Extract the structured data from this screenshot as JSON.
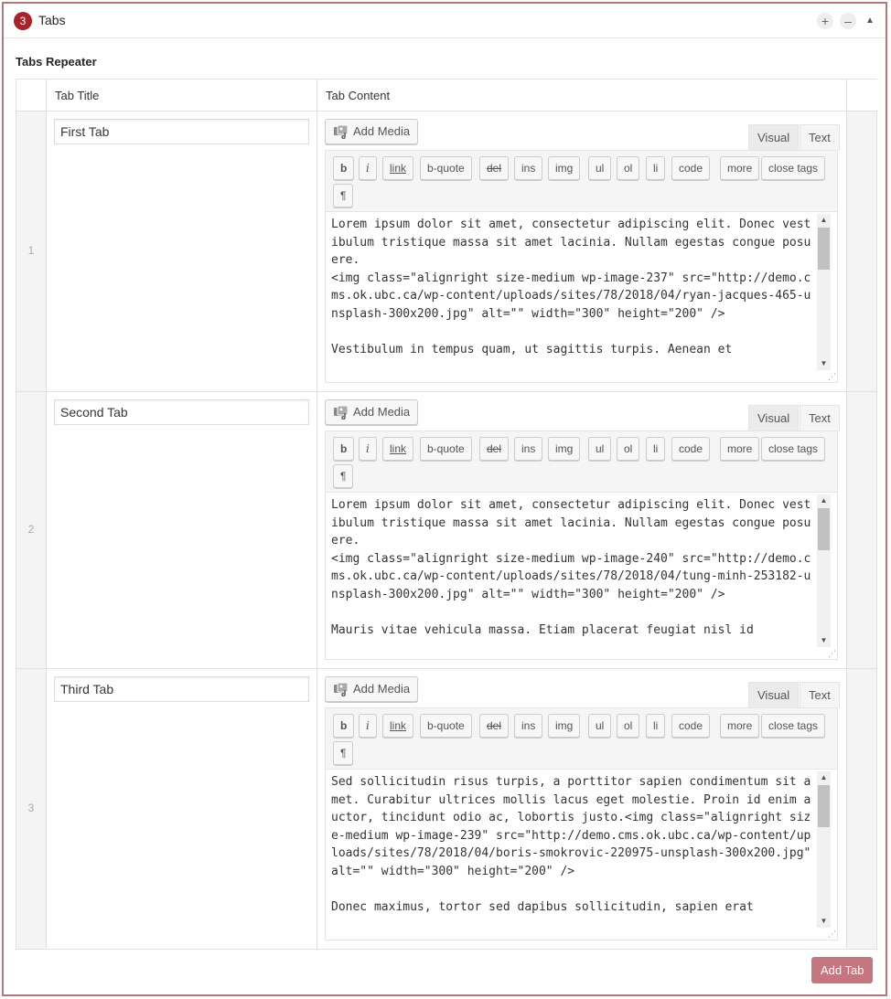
{
  "panel": {
    "badge_count": "3",
    "title": "Tabs",
    "add_symbol": "+",
    "remove_symbol": "–",
    "collapse_symbol": "▲"
  },
  "field": {
    "label": "Tabs Repeater",
    "columns": {
      "tab_title": "Tab Title",
      "tab_content": "Tab Content"
    },
    "rows": [
      {
        "index": "1",
        "title": "First Tab",
        "content": "Lorem ipsum dolor sit amet, consectetur adipiscing elit. Donec vestibulum tristique massa sit amet lacinia. Nullam egestas congue posuere.\n<img class=\"alignright size-medium wp-image-237\" src=\"http://demo.cms.ok.ubc.ca/wp-content/uploads/sites/78/2018/04/ryan-jacques-465-unsplash-300x200.jpg\" alt=\"\" width=\"300\" height=\"200\" />\n\nVestibulum in tempus quam, ut sagittis turpis. Aenean et"
      },
      {
        "index": "2",
        "title": "Second Tab",
        "content": "Lorem ipsum dolor sit amet, consectetur adipiscing elit. Donec vestibulum tristique massa sit amet lacinia. Nullam egestas congue posuere.\n<img class=\"alignright size-medium wp-image-240\" src=\"http://demo.cms.ok.ubc.ca/wp-content/uploads/sites/78/2018/04/tung-minh-253182-unsplash-300x200.jpg\" alt=\"\" width=\"300\" height=\"200\" />\n\nMauris vitae vehicula massa. Etiam placerat feugiat nisl id"
      },
      {
        "index": "3",
        "title": "Third Tab",
        "content": "Sed sollicitudin risus turpis, a porttitor sapien condimentum sit amet. Curabitur ultrices mollis lacus eget molestie. Proin id enim auctor, tincidunt odio ac, lobortis justo.<img class=\"alignright size-medium wp-image-239\" src=\"http://demo.cms.ok.ubc.ca/wp-content/uploads/sites/78/2018/04/boris-smokrovic-220975-unsplash-300x200.jpg\" alt=\"\" width=\"300\" height=\"200\" />\n\nDonec maximus, tortor sed dapibus sollicitudin, sapien erat"
      }
    ]
  },
  "editor": {
    "add_media_label": "Add Media",
    "tab_visual": "Visual",
    "tab_text": "Text",
    "quicktags": [
      "b",
      "i",
      "link",
      "b-quote",
      "del",
      "ins",
      "img",
      "ul",
      "ol",
      "li",
      "code",
      "more",
      "close tags",
      "¶"
    ]
  },
  "footer": {
    "add_tab_label": "Add Tab"
  },
  "colors": {
    "accent": "#a8232a",
    "frame_border": "#b4777c",
    "add_tab_bg": "#c4777f"
  },
  "icons": {
    "media": "media-icon",
    "add": "plus-icon",
    "remove": "minus-icon",
    "collapse": "triangle-up-icon"
  }
}
